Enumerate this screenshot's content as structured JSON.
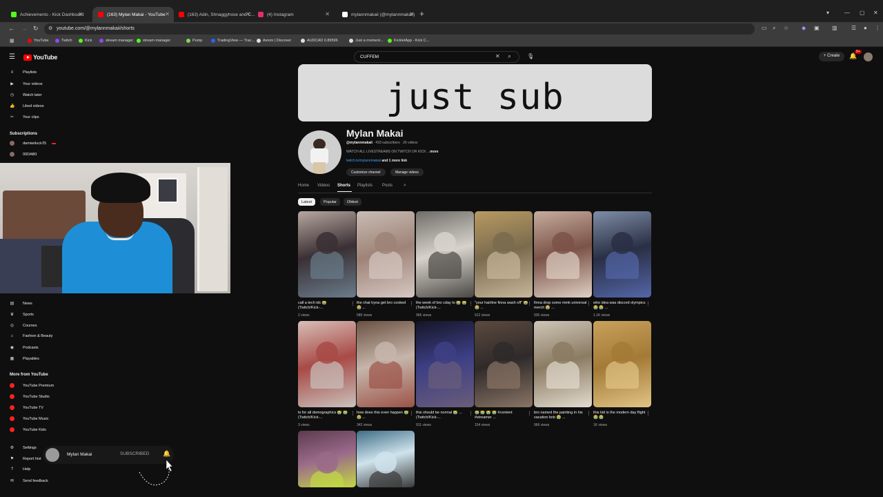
{
  "browser": {
    "tabs": [
      {
        "title": "Achievements - Kick Dashboard",
        "color": "#53fc18",
        "active": false
      },
      {
        "title": "(163) Mylan Makai - YouTube",
        "color": "#ff0000",
        "active": true
      },
      {
        "title": "(163) Adin, Shnaggyhose and C...",
        "color": "#ff0000",
        "active": false
      },
      {
        "title": "(4) Instagram",
        "color": "#e1306c",
        "active": false
      },
      {
        "title": "mylannmakaii (@mylannmakaii)",
        "color": "#ffffff",
        "active": false
      }
    ],
    "tab_close": "✕",
    "new_tab": "+",
    "url": "youtube.com/@mylannmakaii/shorts",
    "bookmarks": [
      {
        "label": "YouTube",
        "color": "#ff0000"
      },
      {
        "label": "Twitch",
        "color": "#9146ff"
      },
      {
        "label": "Kick",
        "color": "#53fc18"
      },
      {
        "label": "stream manager",
        "color": "#9146ff"
      },
      {
        "label": "stream manager",
        "color": "#53fc18"
      },
      {
        "label": "Pump",
        "color": "#7ed957"
      },
      {
        "label": "TradingView — Trac...",
        "color": "#2962ff"
      },
      {
        "label": "Axiom | Discover",
        "color": "#dddddd"
      },
      {
        "label": "AUDCAD 0.89596",
        "color": "#dddddd"
      },
      {
        "label": "Just a moment...",
        "color": "#dddddd"
      },
      {
        "label": "KickletApp - Kick C...",
        "color": "#53fc18"
      }
    ]
  },
  "youtube": {
    "logo_text": "YouTube",
    "search_value": "CUFFEM",
    "create_label": "Create",
    "bell_count": "9+"
  },
  "sidebar": {
    "you_items": [
      {
        "label": "Playlists",
        "icon": "playlist-icon",
        "glyph": "≡"
      },
      {
        "label": "Your videos",
        "icon": "video-icon",
        "glyph": "▶"
      },
      {
        "label": "Watch later",
        "icon": "clock-icon",
        "glyph": "◷"
      },
      {
        "label": "Liked videos",
        "icon": "thumb-up-icon",
        "glyph": "👍"
      },
      {
        "label": "Your clips",
        "icon": "scissors-icon",
        "glyph": "✂"
      }
    ],
    "subscriptions_heading": "Subscriptions",
    "subscriptions": [
      {
        "label": "damianlucir25",
        "live": true
      },
      {
        "label": "00DAB0",
        "live": false
      }
    ],
    "explore_items": [
      {
        "label": "News",
        "icon": "news-icon",
        "glyph": "▤"
      },
      {
        "label": "Sports",
        "icon": "trophy-icon",
        "glyph": "♛"
      },
      {
        "label": "Courses",
        "icon": "courses-icon",
        "glyph": "◎"
      },
      {
        "label": "Fashion & Beauty",
        "icon": "hanger-icon",
        "glyph": "⌂"
      },
      {
        "label": "Podcasts",
        "icon": "podcast-icon",
        "glyph": "◉"
      },
      {
        "label": "Playables",
        "icon": "grid-icon",
        "glyph": "▦"
      }
    ],
    "more_heading": "More from YouTube",
    "more_items": [
      "YouTube Premium",
      "YouTube Studio",
      "YouTube TV",
      "YouTube Music",
      "YouTube Kids"
    ],
    "bottom_items": [
      {
        "label": "Settings",
        "icon": "gear-icon",
        "glyph": "⚙"
      },
      {
        "label": "Report hist",
        "icon": "flag-icon",
        "glyph": "⚑"
      },
      {
        "label": "Help",
        "icon": "help-icon",
        "glyph": "?"
      },
      {
        "label": "Send feedback",
        "icon": "feedback-icon",
        "glyph": "✉"
      }
    ]
  },
  "toast": {
    "channel": "Mylan Makai",
    "status": "SUBSCRIBED"
  },
  "channel": {
    "banner_text": "just sub",
    "name": "Mylan Makai",
    "handle": "@mylannmakaii",
    "subscribers": "418 subscribers",
    "videos": "26 videos",
    "separator": "·",
    "description": "WATCH ALL LIVESTREAMS ON TWITCH OR KICK ...",
    "more": "more",
    "link": "twitch.tv/mylannmakaii",
    "more_links": "and 1 more link",
    "customize_label": "Customize channel",
    "manage_label": "Manage videos",
    "tabs": [
      "Home",
      "Videos",
      "Shorts",
      "Playlists",
      "Posts"
    ],
    "active_tab": "Shorts",
    "filter_chips": [
      "Latest",
      "Popular",
      "Oldest"
    ],
    "active_chip": "Latest"
  },
  "shorts": [
    {
      "title": "call a tech idc 😭 (Twitch/Kick-...",
      "views": "2 views",
      "palette": [
        "#b7a7a0",
        "#3a3034",
        "#6a7c8c"
      ]
    },
    {
      "title": "the chat tryna get bro cooked 😭 ...",
      "views": "580 views",
      "palette": [
        "#c9bcb4",
        "#9e8377",
        "#d6c8c2"
      ]
    },
    {
      "title": "the week of bro cday to 😭 😭 (Twitch/Kick-...",
      "views": "966 views",
      "palette": [
        "#6f6d68",
        "#d7d2cb",
        "#4b4844"
      ]
    },
    {
      "title": "\"your hairline finna wash off\" 😭 😭 ...",
      "views": "912 views",
      "palette": [
        "#b89a62",
        "#7a6b4e",
        "#c7b79a"
      ]
    },
    {
      "title": "finna drop some mmk universal merch 😭 ...",
      "views": "935 views",
      "palette": [
        "#c6ad9e",
        "#7b5248",
        "#dfd0c4"
      ]
    },
    {
      "title": "who idea was discord olympics😭 😭 ...",
      "views": "1.1K views",
      "palette": [
        "#7e8ea6",
        "#2a2f45",
        "#5366a8"
      ]
    },
    {
      "title": "ts for all demographics 😭 😭 (Twitch/Kick-...",
      "views": "3 views",
      "palette": [
        "#d8bfb8",
        "#a84a46",
        "#c9c2bd"
      ]
    },
    {
      "title": "how does this even happen 😭 😭 ...",
      "views": "342 views",
      "palette": [
        "#6a5142",
        "#c6b5aa",
        "#9c5348"
      ]
    },
    {
      "title": "this should be normal 😭 ...(Twitch/Kick-...",
      "views": "911 views",
      "palette": [
        "#151526",
        "#3d3f85",
        "#6a5d7a"
      ]
    },
    {
      "title": "😭 😭 😭 😭 #content #streamer ...",
      "views": "154 views",
      "palette": [
        "#5c4a3f",
        "#2f2a2a",
        "#8a7565"
      ]
    },
    {
      "title": "bro named the painting in his vacation bnb 😭 ...",
      "views": "966 views",
      "palette": [
        "#cfc6b8",
        "#8b7b63",
        "#e3dccf"
      ]
    },
    {
      "title": "this kid is the modern day flight 😭 😭",
      "views": "1K views",
      "palette": [
        "#c8a15c",
        "#a37a36",
        "#e1c486"
      ]
    },
    {
      "title": "",
      "views": "",
      "palette": [
        "#5c3b4e",
        "#9a6a8a",
        "#c2d844"
      ]
    },
    {
      "title": "",
      "views": "",
      "palette": [
        "#3f6e86",
        "#cfe3ec",
        "#3a3a3a"
      ]
    }
  ]
}
